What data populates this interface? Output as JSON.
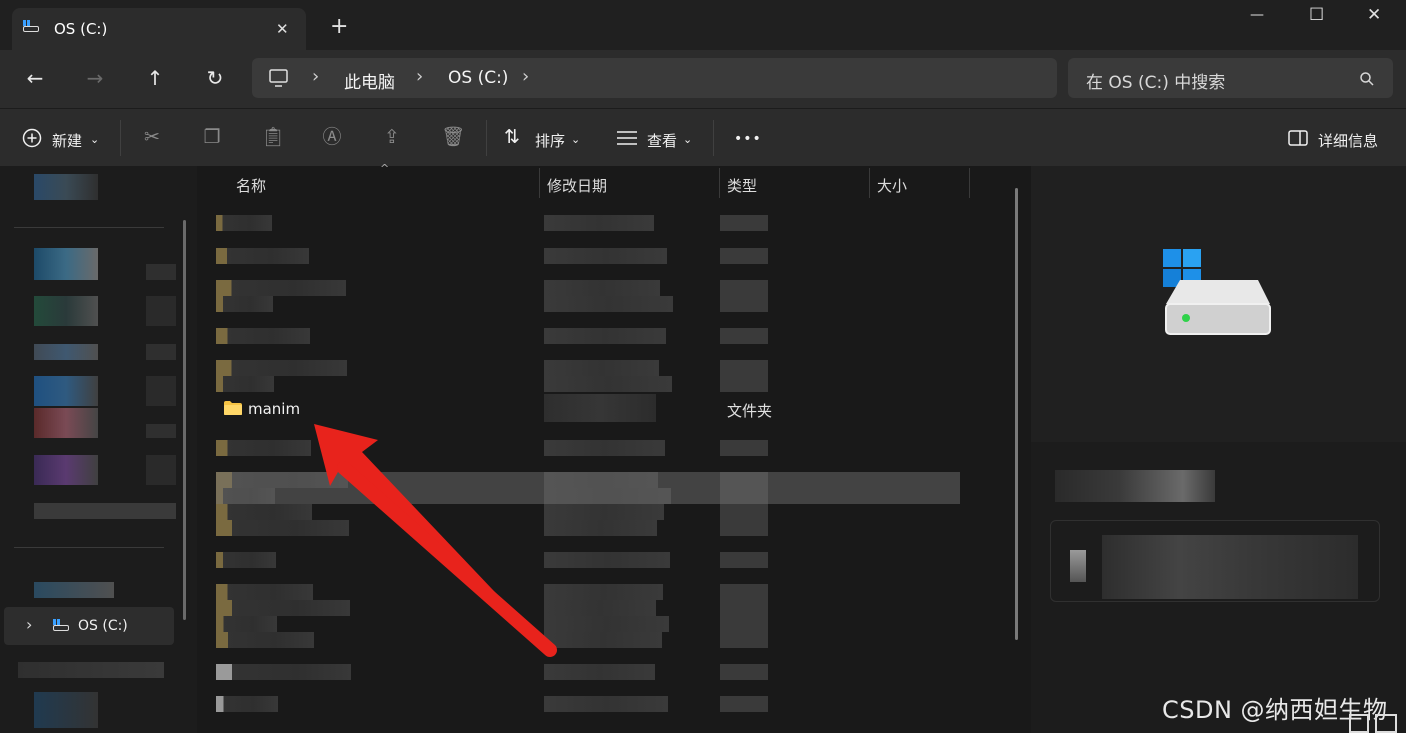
{
  "window": {
    "tab_title": "OS (C:)",
    "tab_close": "✕",
    "new_tab": "+",
    "minimize": "—",
    "maximize": "☐",
    "close": "✕"
  },
  "nav": {
    "back": "←",
    "forward": "→",
    "up": "↑",
    "refresh": "↻",
    "breadcrumb": [
      "此电脑",
      "OS (C:)"
    ],
    "separator": "›",
    "search_placeholder": "在 OS (C:) 中搜索"
  },
  "commands": {
    "new_label": "新建",
    "sort_label": "排序",
    "view_label": "查看",
    "more_label": "•••",
    "details_label": "详细信息"
  },
  "sidebar": {
    "selected_item": "OS (C:)"
  },
  "columns": {
    "name": "名称",
    "modified": "修改日期",
    "type": "类型",
    "size": "大小"
  },
  "visible_row": {
    "name": "manim",
    "type": "文件夹"
  },
  "watermark": "CSDN @纳西妲生物",
  "colors": {
    "arrow": "#e8231c",
    "folder": "#f6c344",
    "accent": "#2f7fd6"
  }
}
